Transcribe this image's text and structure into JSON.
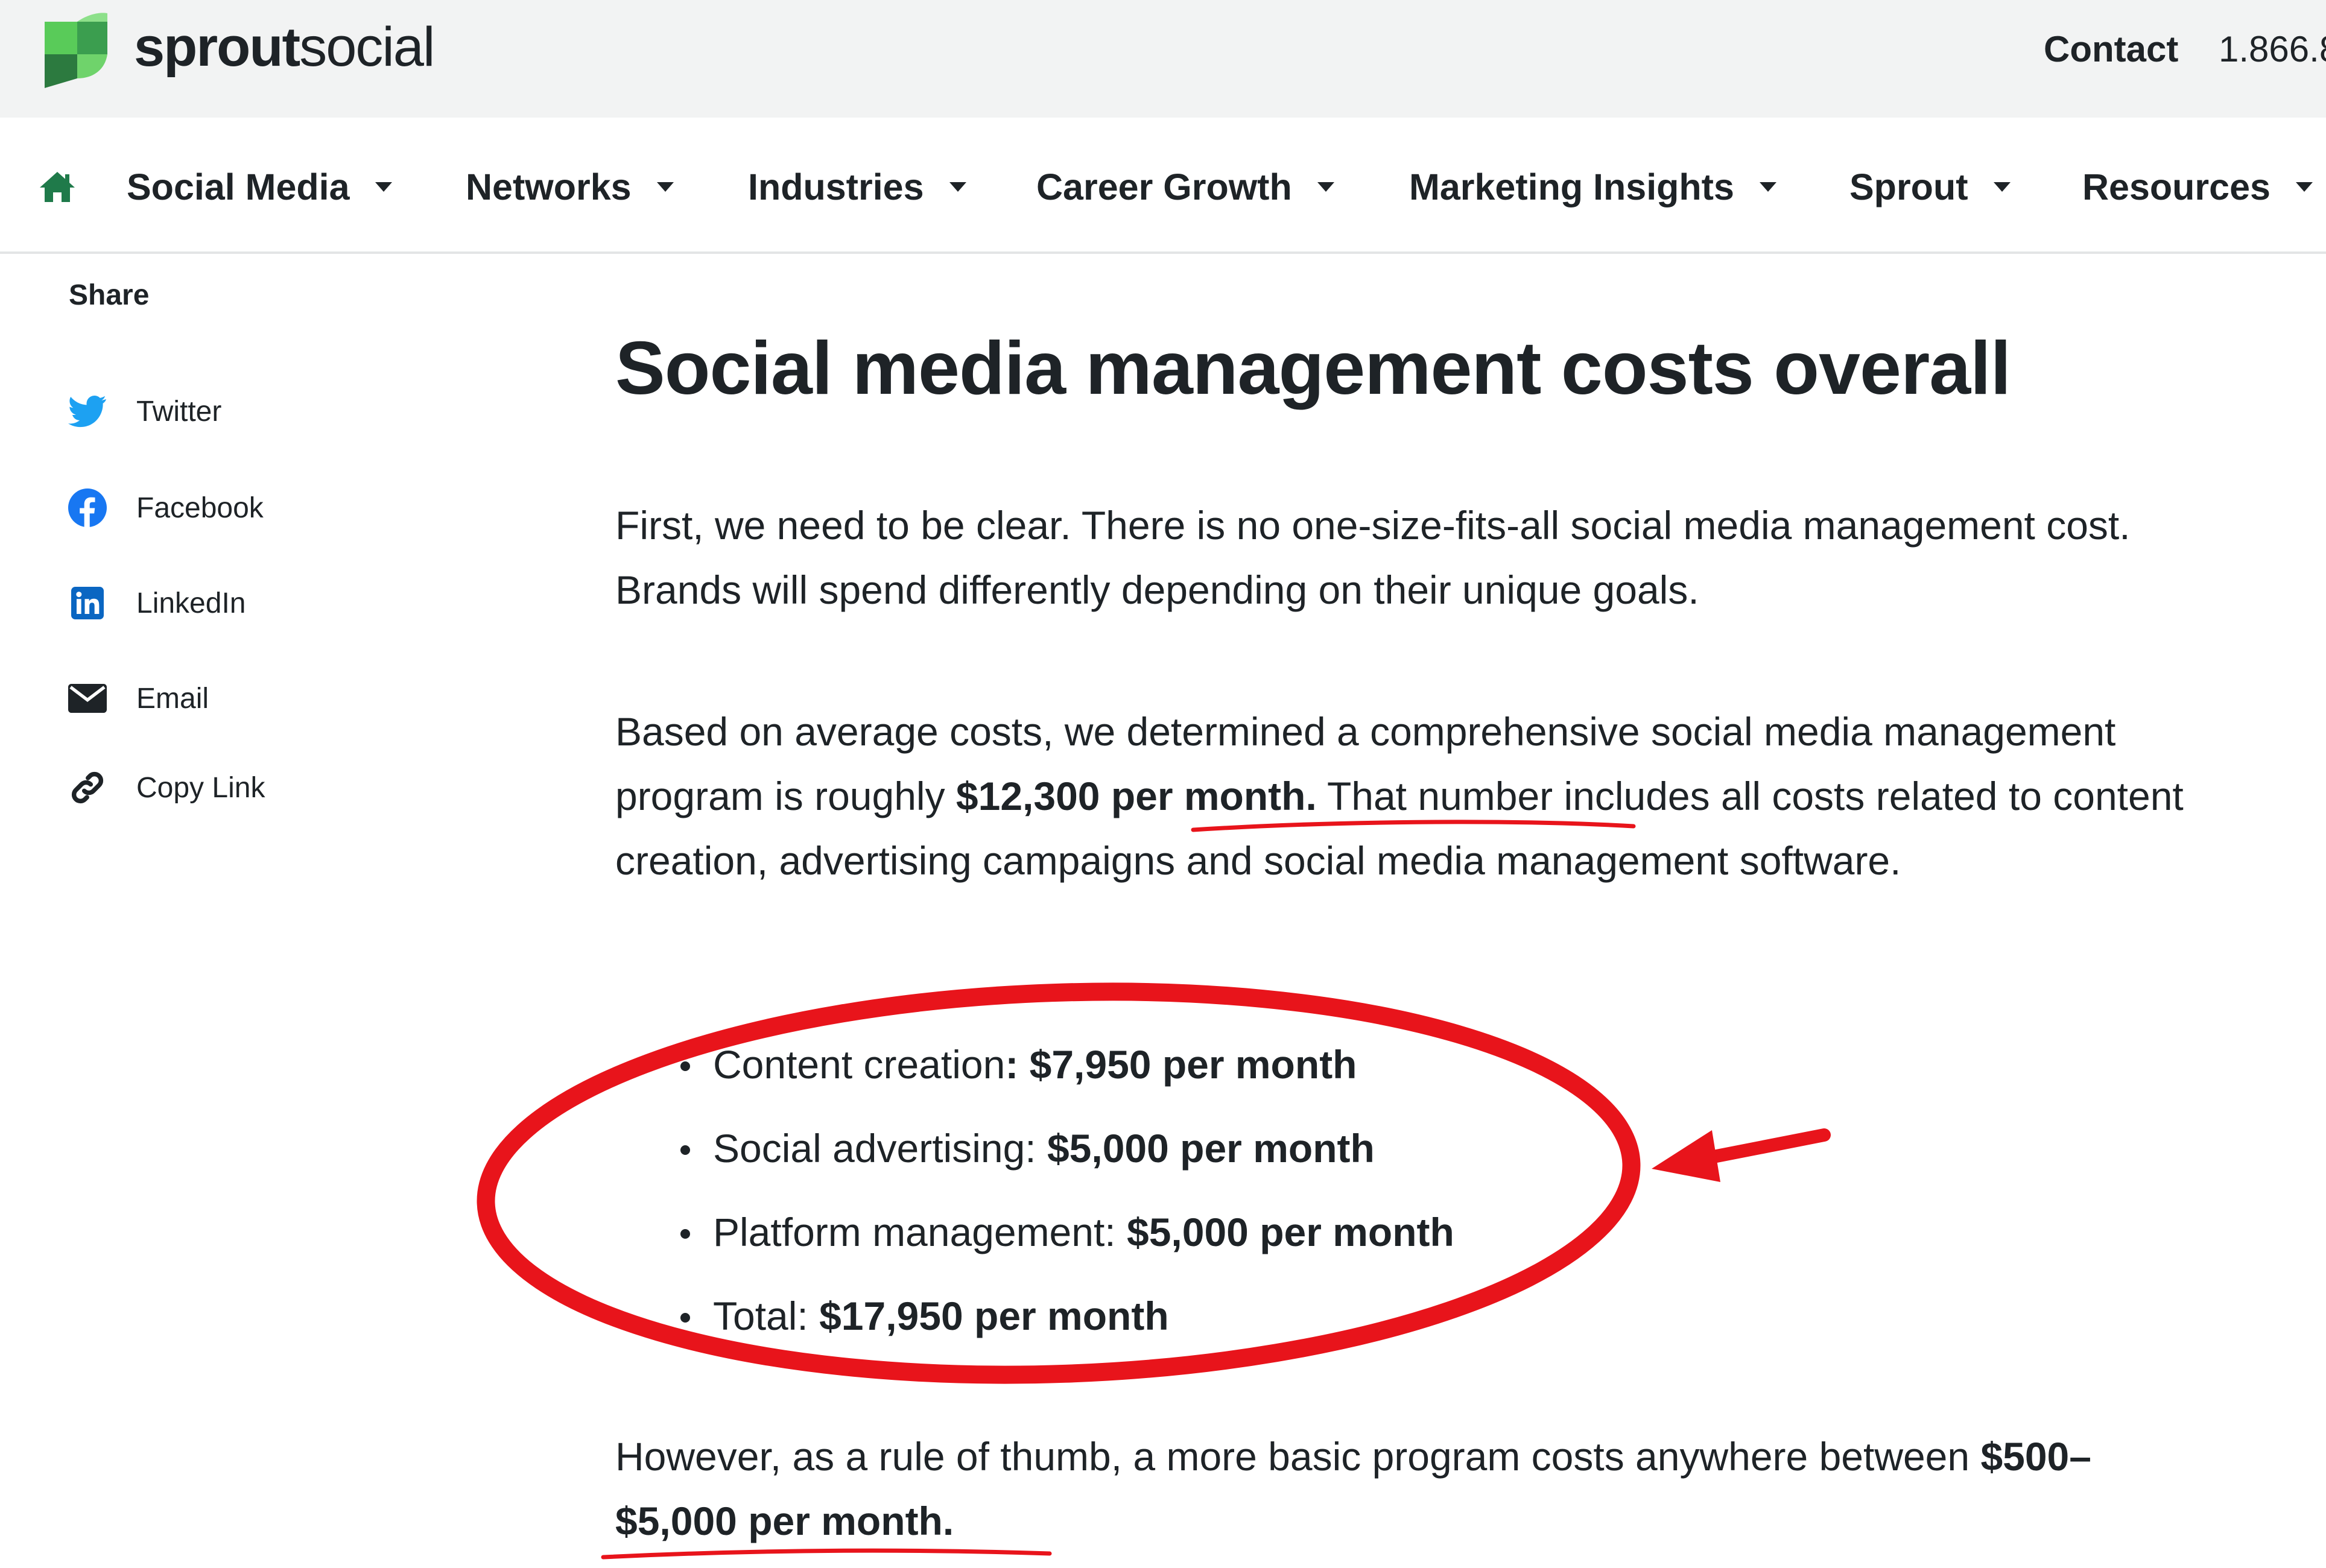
{
  "header": {
    "logo": {
      "bold": "sprout",
      "regular": "social",
      "icon": "sprout-leaf-icon"
    },
    "contact_label": "Contact",
    "phone": "1.866.8"
  },
  "nav": {
    "home_icon": "home-icon",
    "items": [
      {
        "label": "Social Media"
      },
      {
        "label": "Networks"
      },
      {
        "label": "Industries"
      },
      {
        "label": "Career Growth"
      },
      {
        "label": "Marketing Insights"
      },
      {
        "label": "Sprout"
      },
      {
        "label": "Resources"
      }
    ]
  },
  "share": {
    "title": "Share",
    "items": [
      {
        "label": "Twitter",
        "icon": "twitter-icon"
      },
      {
        "label": "Facebook",
        "icon": "facebook-icon"
      },
      {
        "label": "LinkedIn",
        "icon": "linkedin-icon"
      },
      {
        "label": "Email",
        "icon": "email-icon"
      },
      {
        "label": "Copy Link",
        "icon": "link-icon"
      }
    ]
  },
  "article": {
    "heading": "Social media management costs overall",
    "para1": "First, we need to be clear. There is no one-size-fits-all social media management cost. Brands will spend differently depending on their unique goals.",
    "para2": {
      "before": "Based on average costs, we determined a comprehensive social media management program is roughly ",
      "highlight": "$12,300 per month.",
      "after": " That number includes all costs related to content creation, advertising campaigns and social media management software."
    },
    "cost_list": [
      {
        "label": "Content creation",
        "value": ": $7,950 per month"
      },
      {
        "label": "Social advertising: ",
        "value": "$5,000 per month"
      },
      {
        "label": "Platform management: ",
        "value": "$5,000 per month"
      },
      {
        "label": "Total: ",
        "value": "$17,950 per month"
      }
    ],
    "para3": {
      "before": "However, as a rule of thumb, a more basic program costs anywhere between ",
      "highlight": "$500–$5,000 per month."
    }
  },
  "colors": {
    "brand_green": "#59cb59",
    "text": "#1e2327",
    "annotation_red": "#e8141b",
    "twitter_blue": "#1da1f2",
    "facebook_blue": "#1877f2",
    "linkedin_blue": "#0a66c2"
  }
}
